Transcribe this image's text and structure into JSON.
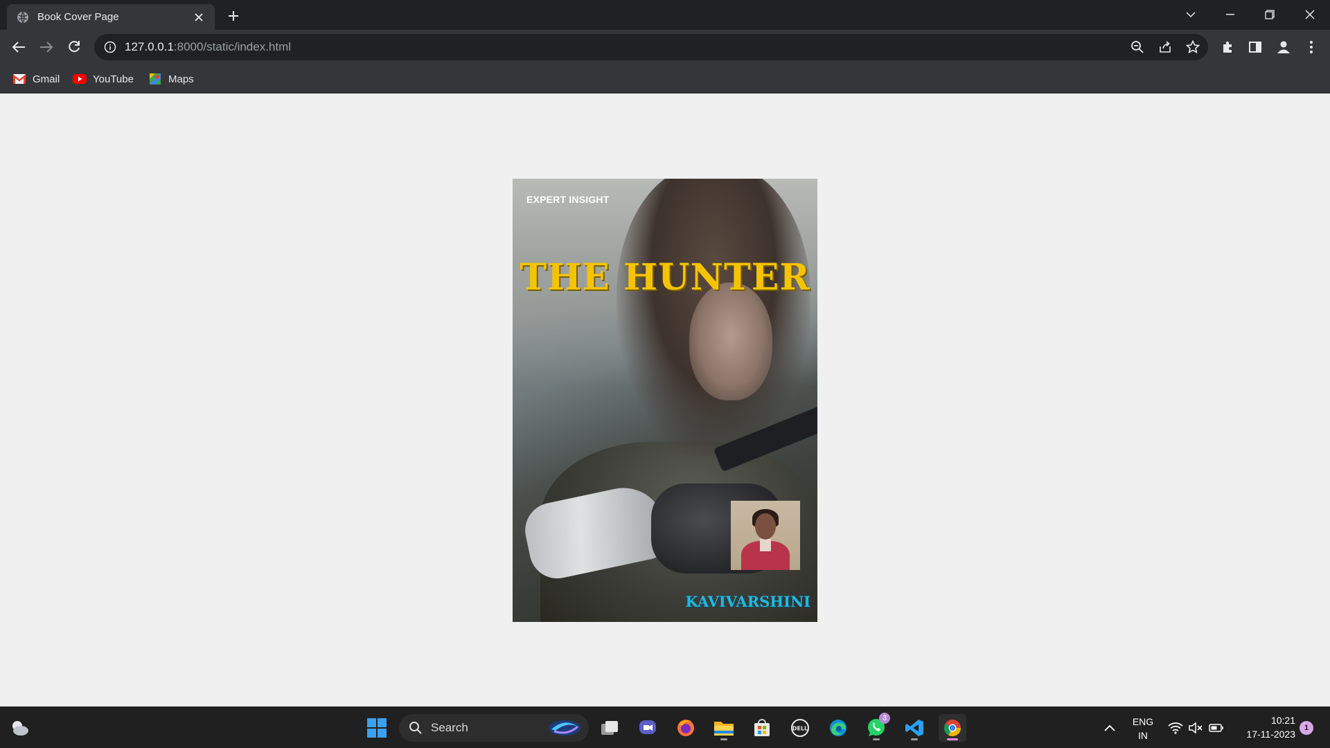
{
  "browser": {
    "tab_title": "Book Cover Page",
    "url_host": "127.0.0.1",
    "url_path": ":8000/static/index.html",
    "bookmarks": [
      {
        "label": "Gmail",
        "icon": "gmail-icon"
      },
      {
        "label": "YouTube",
        "icon": "youtube-icon"
      },
      {
        "label": "Maps",
        "icon": "maps-icon"
      }
    ]
  },
  "cover": {
    "tagline": "EXPERT INSIGHT",
    "title": "THE HUNTER",
    "author": "KAVIVARSHINI",
    "title_color": "#f5c400",
    "author_color": "#22b8e0"
  },
  "taskbar": {
    "search_placeholder": "Search",
    "whatsapp_badge": "3",
    "language": "ENG",
    "region": "IN",
    "time": "10:21",
    "date": "17-11-2023",
    "notification_count": "1",
    "accent": "#0078d4"
  }
}
